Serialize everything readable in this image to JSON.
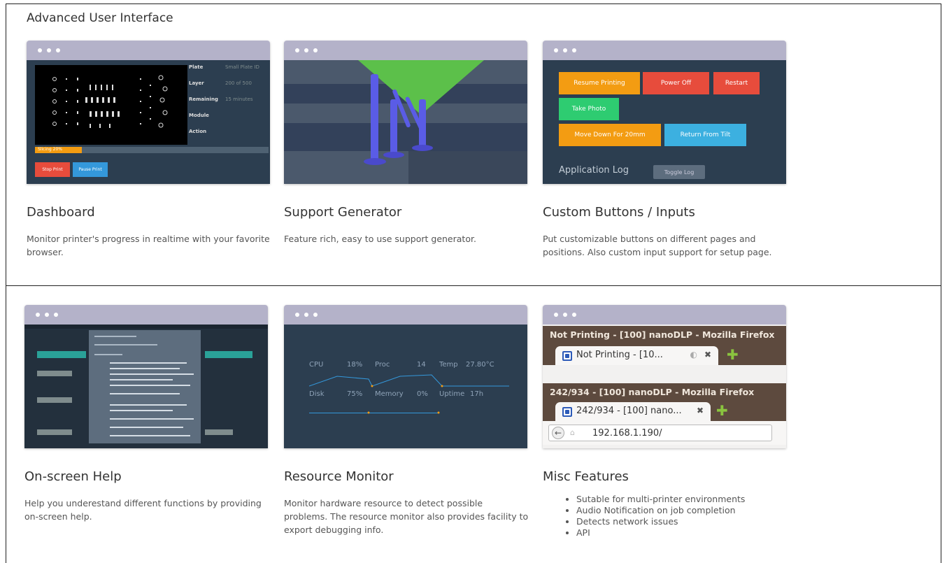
{
  "section_title": "Advanced User Interface",
  "cards": [
    {
      "title": "Dashboard",
      "desc": "Monitor printer's progress in realtime with your favorite browser.",
      "screen": {
        "info_labels": [
          "Plate",
          "Layer",
          "Remaining",
          "Module",
          "Action"
        ],
        "info_values": [
          "Small Plate ID",
          "200 of 500",
          "15 minutes",
          "",
          ""
        ],
        "progress": 0.2,
        "progress_label": "Slicing 20%",
        "btn_stop": "Stop Print",
        "btn_pause": "Pause Print"
      }
    },
    {
      "title": "Support Generator",
      "desc": "Feature rich, easy to use support generator."
    },
    {
      "title": "Custom Buttons / Inputs",
      "desc": "Put customizable buttons on different pages and positions. Also custom input support for setup page.",
      "screen": {
        "buttons": [
          "Resume Printing",
          "Power Off",
          "Restart",
          "Take Photo",
          "Move Down For 20mm",
          "Return From Tilt"
        ],
        "log_label": "Application Log",
        "toggle_log": "Toggle Log"
      }
    },
    {
      "title": "On-screen Help",
      "desc": "Help you underestand different functions by providing on-screen help."
    },
    {
      "title": "Resource Monitor",
      "desc": "Monitor hardware resource to detect possible problems. The resource monitor also provides facility to export debugging info.",
      "screen": {
        "cpu_label": "CPU",
        "cpu_value": "18%",
        "proc_label": "Proc",
        "proc_value": "14",
        "temp_label": "Temp",
        "temp_value": "27.80°C",
        "disk_label": "Disk",
        "disk_value": "75%",
        "memory_label": "Memory",
        "memory_value": "0%",
        "uptime_label": "Uptime",
        "uptime_value": "17h"
      }
    },
    {
      "title": "Misc Features",
      "list": [
        "Sutable for multi-printer environments",
        "Audio Notification on job completion",
        "Detects network issues",
        "API"
      ],
      "screen": {
        "window_title_1": "Not Printing - [100] nanoDLP - Mozilla Firefox",
        "tab_title_1": "Not Printing - [10...",
        "window_title_2": "242/934 - [100] nanoDLP - Mozilla Firefox",
        "tab_title_2": "242/934 - [100] nano...",
        "url": "192.168.1.190/"
      }
    }
  ],
  "colors": {
    "titlebar": "#b4b2c9",
    "screen_bg": "#2c3e50",
    "orange": "#f39c12",
    "red": "#e74c3c",
    "green": "#2ecc71",
    "blue": "#3498db",
    "support_blue": "#5a5ce6",
    "support_green": "#5cc04a",
    "firefox_bar": "#5d4a3e"
  }
}
